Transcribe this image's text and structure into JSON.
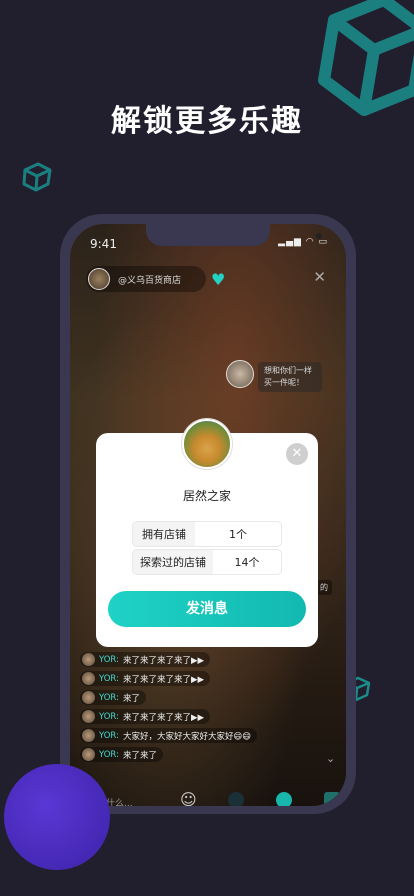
{
  "headline": "解锁更多乐趣",
  "phone": {
    "status_time": "9:41",
    "status_icons": "▂▄▆ ◠ ▭",
    "live_shop": "@义乌百货商店",
    "bubble_text": "想和你们一样买一件呢！",
    "side_fragment": "的",
    "input_placeholder": "说点什么...",
    "chat": [
      {
        "name": "YOR:",
        "text": "来了来了来了来了▶▶"
      },
      {
        "name": "YOR:",
        "text": "来了来了来了来了▶▶"
      },
      {
        "name": "YOR:",
        "text": "来了"
      },
      {
        "name": "YOR:",
        "text": "来了来了来了来了▶▶"
      },
      {
        "name": "YOR:",
        "text": "大家好，大家好大家好大家好😄😄"
      },
      {
        "name": "YOR:",
        "text": "来了来了"
      }
    ]
  },
  "card": {
    "name": "居然之家",
    "stats": [
      {
        "label": "拥有店铺",
        "value": "1个"
      },
      {
        "label": "探索过的店铺",
        "value": "14个"
      }
    ],
    "send_label": "发消息"
  },
  "colors": {
    "accent": "#1fd2c6",
    "background": "#211f2e",
    "purple": "#4a2ec0"
  },
  "icons": [
    "cube-icon",
    "heart-icon",
    "close-icon",
    "smile-icon",
    "chevron-down-icon"
  ]
}
